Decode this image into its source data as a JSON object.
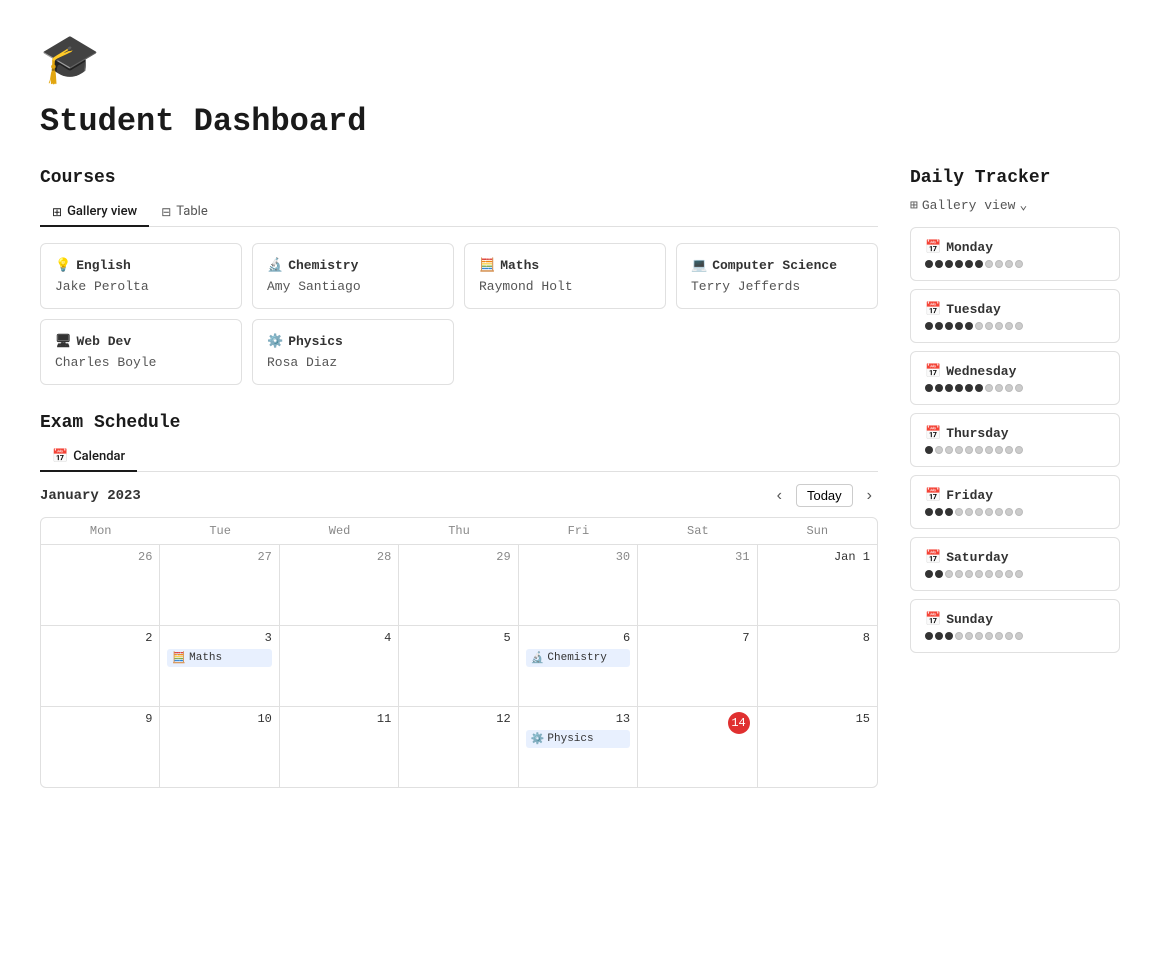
{
  "logo": "🎓",
  "page_title": "Student Dashboard",
  "courses": {
    "section_title": "Courses",
    "tabs": [
      {
        "label": "Gallery view",
        "icon": "⊞",
        "active": true
      },
      {
        "label": "Table",
        "icon": "⊟",
        "active": false
      }
    ],
    "items": [
      {
        "icon": "💡",
        "name": "English",
        "teacher": "Jake Perolta"
      },
      {
        "icon": "🔬",
        "name": "Chemistry",
        "teacher": "Amy Santiago"
      },
      {
        "icon": "🧮",
        "name": "Maths",
        "teacher": "Raymond Holt"
      },
      {
        "icon": "💻",
        "name": "Computer Science",
        "teacher": "Terry Jefferds"
      },
      {
        "icon": "🖥",
        "name": "Web Dev",
        "teacher": "Charles Boyle"
      },
      {
        "icon": "⚙️",
        "name": "Physics",
        "teacher": "Rosa Diaz"
      }
    ]
  },
  "exam_schedule": {
    "section_title": "Exam Schedule",
    "tab": {
      "label": "Calendar",
      "icon": "📅"
    },
    "month": "January 2023",
    "today_label": "Today",
    "day_labels": [
      "Mon",
      "Tue",
      "Wed",
      "Thu",
      "Fri",
      "Sat",
      "Sun"
    ],
    "weeks": [
      {
        "days": [
          {
            "num": "26",
            "current": false,
            "events": []
          },
          {
            "num": "27",
            "current": false,
            "events": []
          },
          {
            "num": "28",
            "current": false,
            "events": []
          },
          {
            "num": "29",
            "current": false,
            "events": []
          },
          {
            "num": "30",
            "current": false,
            "events": []
          },
          {
            "num": "31",
            "current": false,
            "events": []
          },
          {
            "num": "Jan 1",
            "current": true,
            "events": []
          }
        ]
      },
      {
        "days": [
          {
            "num": "2",
            "current": true,
            "events": []
          },
          {
            "num": "3",
            "current": true,
            "events": [
              {
                "label": "Maths",
                "type": "maths",
                "icon": "🧮"
              }
            ]
          },
          {
            "num": "4",
            "current": true,
            "events": []
          },
          {
            "num": "5",
            "current": true,
            "events": []
          },
          {
            "num": "6",
            "current": true,
            "events": [
              {
                "label": "Chemistry",
                "type": "chemistry",
                "icon": "🔬"
              }
            ]
          },
          {
            "num": "7",
            "current": true,
            "events": []
          },
          {
            "num": "8",
            "current": true,
            "events": []
          }
        ]
      },
      {
        "days": [
          {
            "num": "9",
            "current": true,
            "events": []
          },
          {
            "num": "10",
            "current": true,
            "events": []
          },
          {
            "num": "11",
            "current": true,
            "events": []
          },
          {
            "num": "12",
            "current": true,
            "events": []
          },
          {
            "num": "13",
            "current": true,
            "events": [
              {
                "label": "Physics",
                "type": "physics",
                "icon": "⚙️"
              }
            ]
          },
          {
            "num": "14",
            "current": true,
            "today": true,
            "events": []
          },
          {
            "num": "15",
            "current": true,
            "events": []
          }
        ]
      }
    ]
  },
  "daily_tracker": {
    "section_title": "Daily Tracker",
    "view_label": "Gallery view",
    "view_icon": "⊞",
    "days": [
      {
        "icon": "📅",
        "name": "Monday",
        "filled": 6,
        "total": 10
      },
      {
        "icon": "📅",
        "name": "Tuesday",
        "filled": 5,
        "total": 10
      },
      {
        "icon": "📅",
        "name": "Wednesday",
        "filled": 6,
        "total": 10
      },
      {
        "icon": "📅",
        "name": "Thursday",
        "filled": 1,
        "total": 10
      },
      {
        "icon": "📅",
        "name": "Friday",
        "filled": 3,
        "total": 10
      },
      {
        "icon": "📅",
        "name": "Saturday",
        "filled": 2,
        "total": 10
      },
      {
        "icon": "📅",
        "name": "Sunday",
        "filled": 3,
        "total": 10
      }
    ]
  }
}
